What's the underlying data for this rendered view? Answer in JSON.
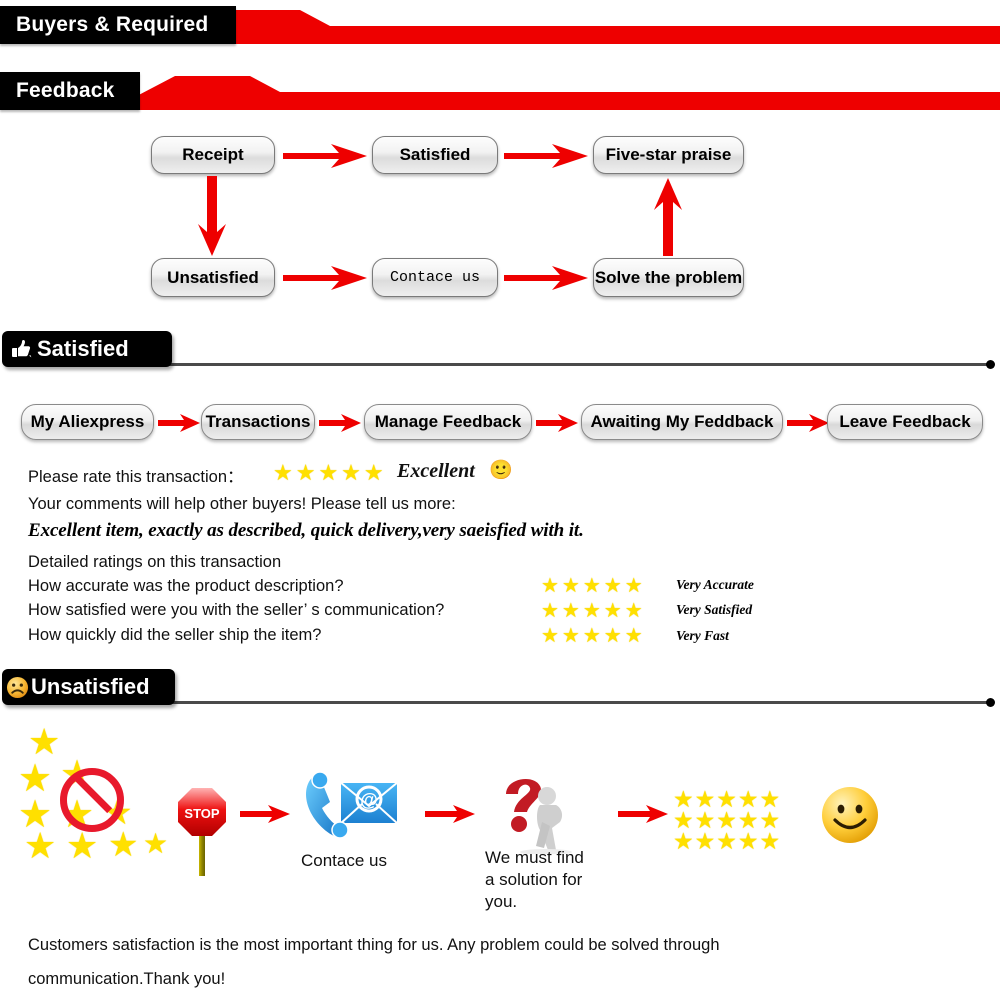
{
  "banners": [
    {
      "title": "Buyers & Required"
    },
    {
      "title": "Feedback"
    }
  ],
  "flow": {
    "nodes": [
      {
        "label": "Receipt"
      },
      {
        "label": "Satisfied"
      },
      {
        "label": "Five-star praise"
      },
      {
        "label": "Unsatisfied"
      },
      {
        "label": "Contace us"
      },
      {
        "label": "Solve the problem"
      }
    ]
  },
  "satisfied_section": {
    "tab_label": "Satisfied",
    "tab_icon": "thumbs-up-icon",
    "breadcrumb": [
      {
        "label": "My Aliexpress"
      },
      {
        "label": "Transactions"
      },
      {
        "label": "Manage Feedback"
      },
      {
        "label": "Awaiting My Feddback"
      },
      {
        "label": "Leave Feedback"
      }
    ],
    "rate_prompt": "Please rate this transaction：",
    "rate_stars": "★★★★★",
    "rate_word": "Excellent",
    "rate_emoji": "🙂",
    "comments_prompt": "Your comments will help other buyers! Please tell us more:",
    "comment_text": "Excellent item, exactly as described, quick delivery,very saeisfied with it.",
    "detailed_heading": "Detailed ratings on this transaction",
    "detailed_rows": [
      {
        "question": "How accurate was the product description?",
        "stars": "★★★★★",
        "verdict": "Very Accurate"
      },
      {
        "question": "How satisfied were you with the seller’ s communication?",
        "stars": "★★★★★",
        "verdict": "Very Satisfied"
      },
      {
        "question": "How quickly did the seller ship the item?",
        "stars": "★★★★★",
        "verdict": "Very Fast"
      }
    ]
  },
  "unsatisfied_section": {
    "tab_label": "Unsatisfied",
    "tab_icon": "frowning-face-icon",
    "steps": [
      {
        "icon": "no-stars-icon",
        "caption": ""
      },
      {
        "icon": "stop-sign-icon",
        "caption": "",
        "sign_text": "STOP"
      },
      {
        "icon": "phone-email-icon",
        "caption": "Contace us",
        "at_symbol": "@"
      },
      {
        "icon": "question-mark-person-icon",
        "caption": "We must find\na solution for\nyou."
      },
      {
        "icon": "five-star-grid-icon",
        "caption": ""
      },
      {
        "icon": "smiley-face-icon",
        "caption": ""
      }
    ],
    "star_grid_rows": [
      "★★★★★",
      "★★★★★",
      "★★★★★"
    ],
    "smiley": "🙂"
  },
  "footer": {
    "line1": "Customers satisfaction is the most important thing for us. Any problem could be solved through",
    "line2": "communication.Thank you!"
  },
  "colors": {
    "red": "#ee0000",
    "black": "#000000",
    "star_yellow": "#ffe000",
    "pill_border": "#7a7a7a"
  }
}
